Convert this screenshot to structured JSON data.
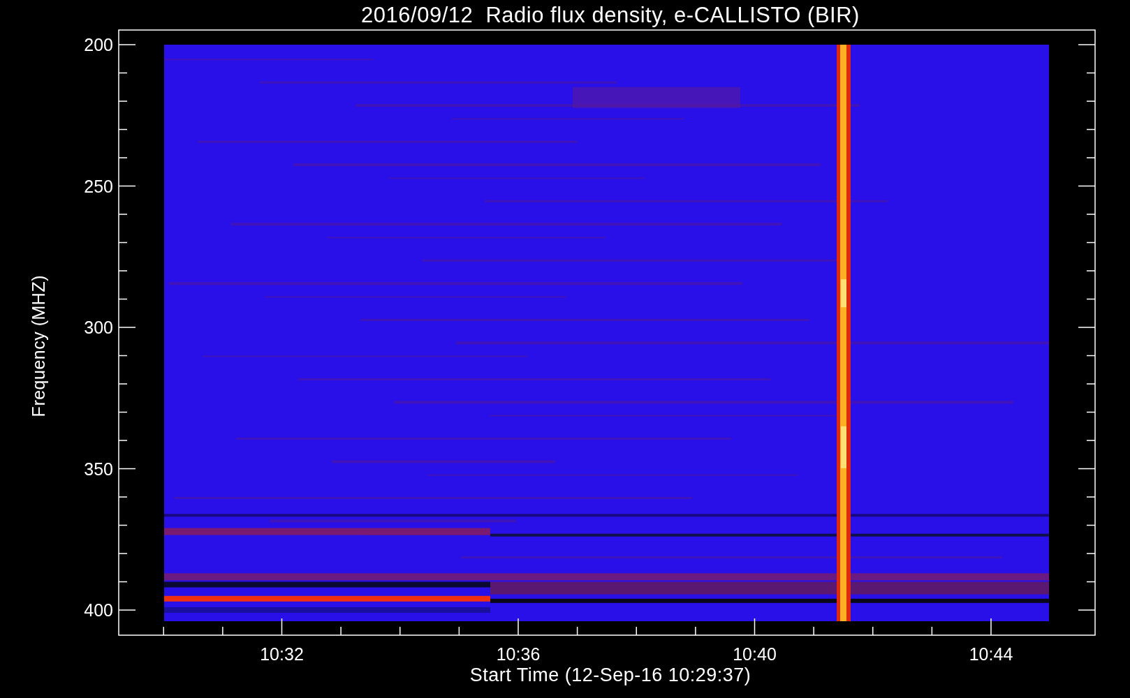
{
  "title": "2016/09/12  Radio flux density, e-CALLISTO (BIR)",
  "y_axis": {
    "label": "Frequency (MHZ)",
    "ticks": [
      "200",
      "250",
      "300",
      "350",
      "400"
    ]
  },
  "x_axis": {
    "label": "Start Time (12-Sep-16 10:29:37)",
    "ticks": [
      "10:32",
      "10:36",
      "10:40",
      "10:44"
    ]
  }
}
